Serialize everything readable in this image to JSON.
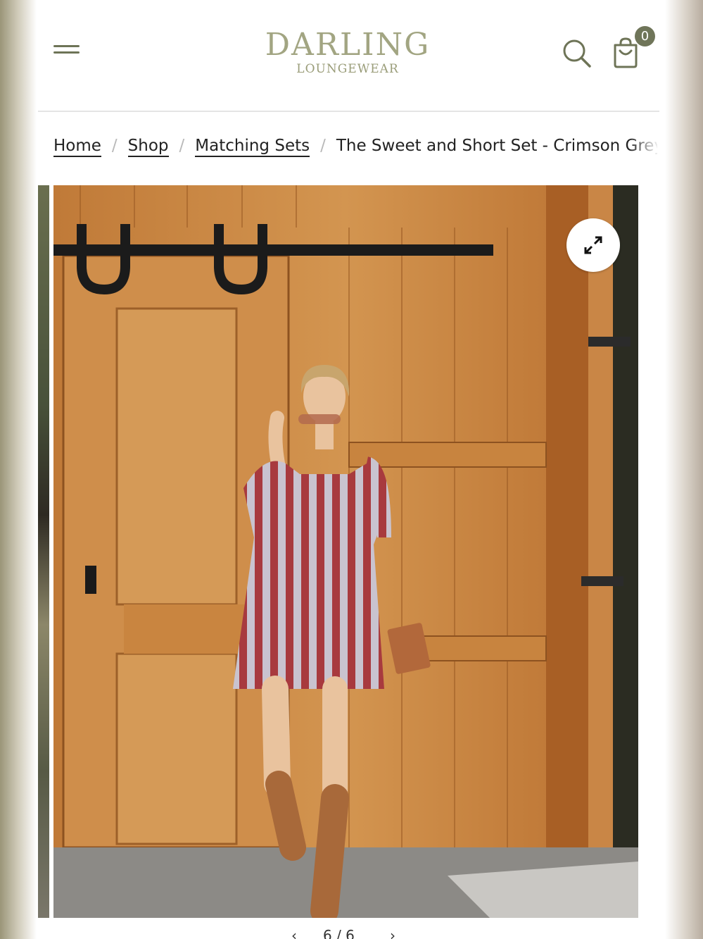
{
  "header": {
    "brand_line1": "DARLING",
    "brand_line2": "LOUNGEWEAR",
    "cart_count": "0",
    "menu_icon": "hamburger-icon",
    "search_icon": "search-icon",
    "cart_icon": "shopping-bag-icon",
    "brand_color": "#a2a582",
    "badge_color": "#6f7559"
  },
  "breadcrumb": {
    "items": [
      {
        "label": "Home"
      },
      {
        "label": "Shop"
      },
      {
        "label": "Matching Sets"
      }
    ],
    "current": "The Sweet and Short Set - Crimson Grey"
  },
  "gallery": {
    "expand_icon": "expand-icon",
    "pager_prev_icon": "chevron-left-icon",
    "pager_next_icon": "chevron-right-icon",
    "pager_text": "6 / 6"
  }
}
